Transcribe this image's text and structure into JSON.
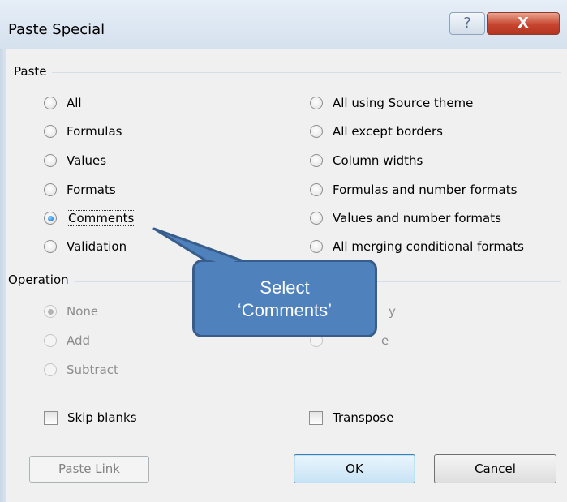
{
  "dialog": {
    "title": "Paste Special",
    "help_glyph": "?",
    "close_glyph": "X"
  },
  "paste_group": {
    "label": "Paste",
    "left_options": [
      "All",
      "Formulas",
      "Values",
      "Formats",
      "Comments",
      "Validation"
    ],
    "right_options": [
      "All using Source theme",
      "All except borders",
      "Column widths",
      "Formulas and number formats",
      "Values and number formats",
      "All merging conditional formats"
    ],
    "selected": "Comments"
  },
  "operation_group": {
    "label": "Operation",
    "left_options": [
      "None",
      "Add",
      "Subtract"
    ],
    "right_partial": [
      "y",
      "e"
    ],
    "selected": "None"
  },
  "checkboxes": {
    "skip_blanks": "Skip blanks",
    "transpose": "Transpose"
  },
  "buttons": {
    "paste_link": "Paste Link",
    "ok": "OK",
    "cancel": "Cancel"
  },
  "callout": {
    "line1": "Select",
    "line2": "‘Comments’",
    "fill": "#4f81bd",
    "border": "#385d8a"
  }
}
